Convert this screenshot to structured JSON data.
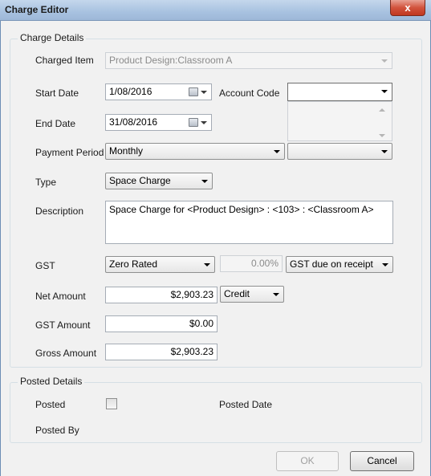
{
  "window": {
    "title": "Charge Editor",
    "close_glyph": "x"
  },
  "charge_details": {
    "legend": "Charge Details",
    "charged_item": {
      "label": "Charged Item",
      "value": "Product Design:Classroom A"
    },
    "start_date": {
      "label": "Start Date",
      "value": "1/08/2016"
    },
    "end_date": {
      "label": "End Date",
      "value": "31/08/2016"
    },
    "account_code": {
      "label": "Account Code",
      "value": ""
    },
    "payment_period": {
      "label": "Payment Period",
      "value": "Monthly",
      "secondary_value": ""
    },
    "type": {
      "label": "Type",
      "value": "Space Charge"
    },
    "description": {
      "label": "Description",
      "value": "Space Charge for <Product Design> : <103> : <Classroom A>"
    },
    "gst": {
      "label": "GST",
      "value": "Zero Rated",
      "percent": "0.00%",
      "mode": "GST due on receipt"
    },
    "net_amount": {
      "label": "Net Amount",
      "value": "$2,903.23",
      "type": "Credit"
    },
    "gst_amount": {
      "label": "GST Amount",
      "value": "$0.00"
    },
    "gross_amount": {
      "label": "Gross Amount",
      "value": "$2,903.23"
    }
  },
  "posted_details": {
    "legend": "Posted Details",
    "posted_label": "Posted",
    "posted_checked": false,
    "posted_date_label": "Posted Date",
    "posted_by_label": "Posted By"
  },
  "buttons": {
    "ok": "OK",
    "cancel": "Cancel"
  },
  "colors": {
    "title_bar": "#b6cbe4",
    "close_button": "#d2533d",
    "dialog_bg": "#f1f1f1"
  }
}
